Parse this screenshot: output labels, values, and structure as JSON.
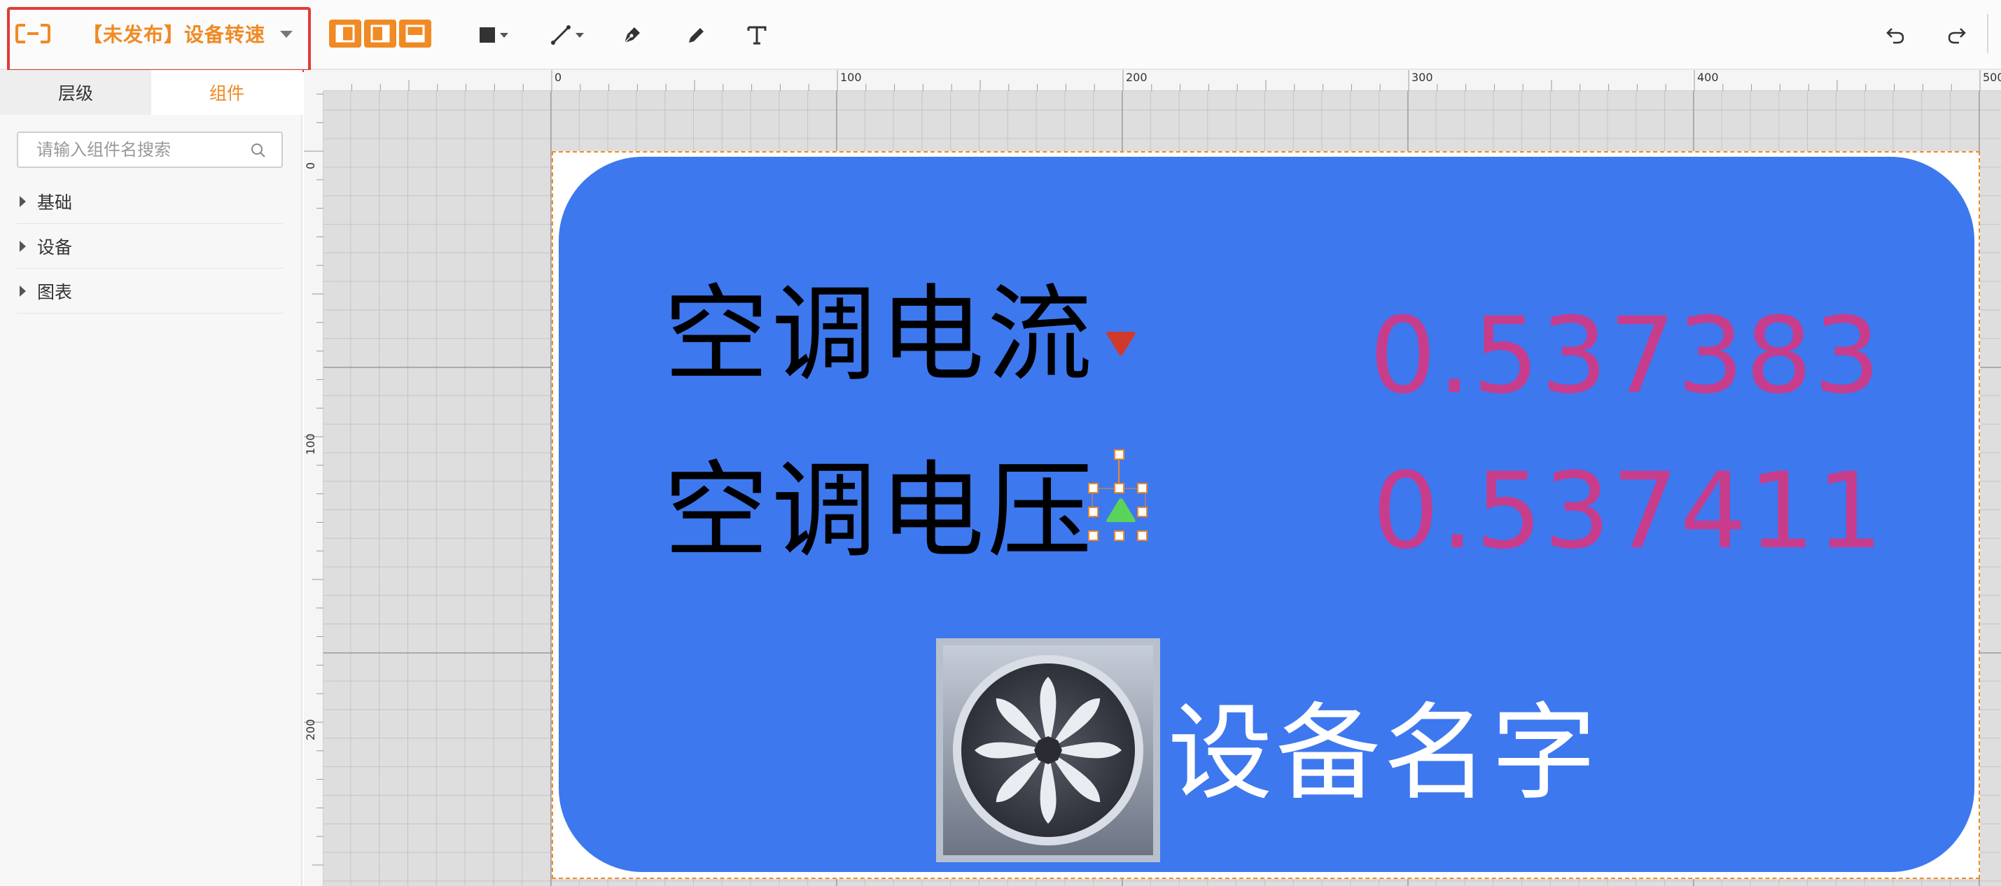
{
  "header": {
    "title": "【未发布】设备转速"
  },
  "toolbar": {
    "layout_buttons": [
      "layout-left-icon",
      "layout-right-icon",
      "layout-bottom-icon"
    ],
    "tools": [
      "rectangle-icon",
      "line-icon",
      "pen-icon",
      "pencil-icon",
      "text-icon"
    ],
    "undo": "undo-icon",
    "redo": "redo-icon"
  },
  "sidebar": {
    "tabs": [
      {
        "label": "层级",
        "active": false
      },
      {
        "label": "组件",
        "active": true
      }
    ],
    "search_placeholder": "请输入组件名搜索",
    "items": [
      {
        "label": "基础"
      },
      {
        "label": "设备"
      },
      {
        "label": "图表"
      }
    ]
  },
  "rulers": {
    "top": [
      "0",
      "100",
      "200",
      "300",
      "400",
      "500"
    ],
    "left": [
      "0",
      "100",
      "200"
    ]
  },
  "canvas": {
    "rows": [
      {
        "label": "空调电流",
        "indicator": "down-triangle-icon",
        "indicator_color": "#d03a2c",
        "value": "0.537383"
      },
      {
        "label": "空调电压",
        "indicator": "up-triangle-icon",
        "indicator_color": "#5ad35a",
        "value": "0.537411"
      }
    ],
    "device_name": "设备名字",
    "device_icon": "fan-icon",
    "card_color": "#3d78ef",
    "value_color": "#c83c8c"
  },
  "colors": {
    "accent": "#f08a24",
    "highlight_border": "#e03c37"
  }
}
